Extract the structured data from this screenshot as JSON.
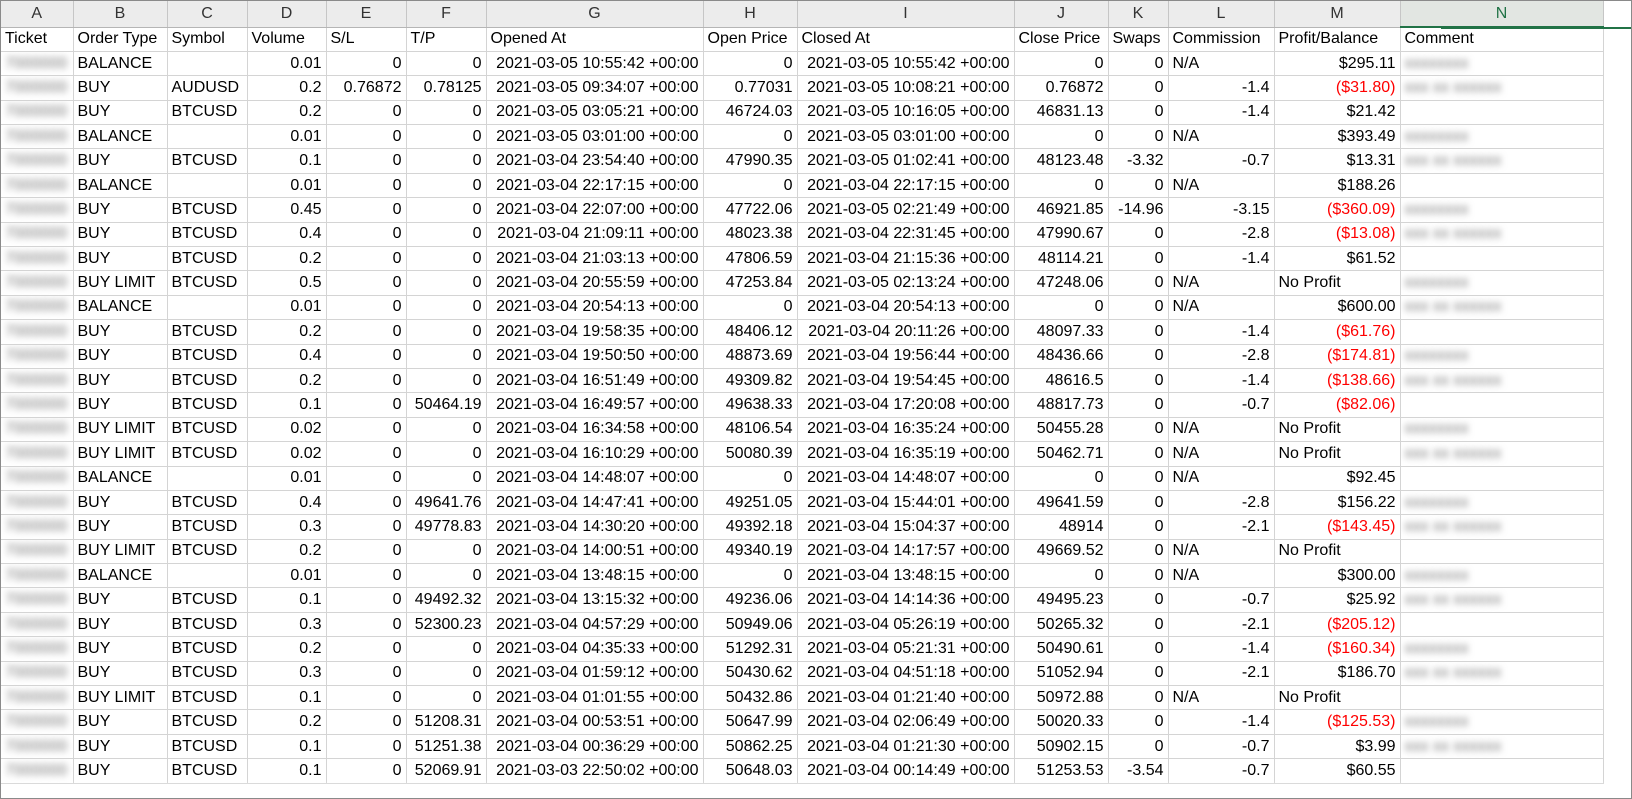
{
  "columns": [
    "A",
    "B",
    "C",
    "D",
    "E",
    "F",
    "G",
    "H",
    "I",
    "J",
    "K",
    "L",
    "M",
    "N"
  ],
  "selected_column": "N",
  "header_row": [
    "Ticket",
    "Order Type",
    "Symbol",
    "Volume",
    "S/L",
    "T/P",
    "Opened At",
    "Open Price",
    "Closed At",
    "Close Price",
    "Swaps",
    "Commission",
    "Profit/Balance",
    "Comment"
  ],
  "colors": {
    "negative": "#ff0000",
    "selected_header": "#217346",
    "grid": "#d4d4d4"
  },
  "rows": [
    [
      "BALANCE",
      "",
      "0.01",
      "0",
      "0",
      "2021-03-05 10:55:42 +00:00",
      "0",
      "2021-03-05 10:55:42 +00:00",
      "0",
      "0",
      "N/A",
      "$295.11"
    ],
    [
      "BUY",
      "AUDUSD",
      "0.2",
      "0.76872",
      "0.78125",
      "2021-03-05 09:34:07 +00:00",
      "0.77031",
      "2021-03-05 10:08:21 +00:00",
      "0.76872",
      "0",
      "-1.4",
      "($31.80)"
    ],
    [
      "BUY",
      "BTCUSD",
      "0.2",
      "0",
      "0",
      "2021-03-05 03:05:21 +00:00",
      "46724.03",
      "2021-03-05 10:16:05 +00:00",
      "46831.13",
      "0",
      "-1.4",
      "$21.42"
    ],
    [
      "BALANCE",
      "",
      "0.01",
      "0",
      "0",
      "2021-03-05 03:01:00 +00:00",
      "0",
      "2021-03-05 03:01:00 +00:00",
      "0",
      "0",
      "N/A",
      "$393.49"
    ],
    [
      "BUY",
      "BTCUSD",
      "0.1",
      "0",
      "0",
      "2021-03-04 23:54:40 +00:00",
      "47990.35",
      "2021-03-05 01:02:41 +00:00",
      "48123.48",
      "-3.32",
      "-0.7",
      "$13.31"
    ],
    [
      "BALANCE",
      "",
      "0.01",
      "0",
      "0",
      "2021-03-04 22:17:15 +00:00",
      "0",
      "2021-03-04 22:17:15 +00:00",
      "0",
      "0",
      "N/A",
      "$188.26"
    ],
    [
      "BUY",
      "BTCUSD",
      "0.45",
      "0",
      "0",
      "2021-03-04 22:07:00 +00:00",
      "47722.06",
      "2021-03-05 02:21:49 +00:00",
      "46921.85",
      "-14.96",
      "-3.15",
      "($360.09)"
    ],
    [
      "BUY",
      "BTCUSD",
      "0.4",
      "0",
      "0",
      "2021-03-04 21:09:11 +00:00",
      "48023.38",
      "2021-03-04 22:31:45 +00:00",
      "47990.67",
      "0",
      "-2.8",
      "($13.08)"
    ],
    [
      "BUY",
      "BTCUSD",
      "0.2",
      "0",
      "0",
      "2021-03-04 21:03:13 +00:00",
      "47806.59",
      "2021-03-04 21:15:36 +00:00",
      "48114.21",
      "0",
      "-1.4",
      "$61.52"
    ],
    [
      "BUY LIMIT",
      "BTCUSD",
      "0.5",
      "0",
      "0",
      "2021-03-04 20:55:59 +00:00",
      "47253.84",
      "2021-03-05 02:13:24 +00:00",
      "47248.06",
      "0",
      "N/A",
      "No Profit"
    ],
    [
      "BALANCE",
      "",
      "0.01",
      "0",
      "0",
      "2021-03-04 20:54:13 +00:00",
      "0",
      "2021-03-04 20:54:13 +00:00",
      "0",
      "0",
      "N/A",
      "$600.00"
    ],
    [
      "BUY",
      "BTCUSD",
      "0.2",
      "0",
      "0",
      "2021-03-04 19:58:35 +00:00",
      "48406.12",
      "2021-03-04 20:11:26 +00:00",
      "48097.33",
      "0",
      "-1.4",
      "($61.76)"
    ],
    [
      "BUY",
      "BTCUSD",
      "0.4",
      "0",
      "0",
      "2021-03-04 19:50:50 +00:00",
      "48873.69",
      "2021-03-04 19:56:44 +00:00",
      "48436.66",
      "0",
      "-2.8",
      "($174.81)"
    ],
    [
      "BUY",
      "BTCUSD",
      "0.2",
      "0",
      "0",
      "2021-03-04 16:51:49 +00:00",
      "49309.82",
      "2021-03-04 19:54:45 +00:00",
      "48616.5",
      "0",
      "-1.4",
      "($138.66)"
    ],
    [
      "BUY",
      "BTCUSD",
      "0.1",
      "0",
      "50464.19",
      "2021-03-04 16:49:57 +00:00",
      "49638.33",
      "2021-03-04 17:20:08 +00:00",
      "48817.73",
      "0",
      "-0.7",
      "($82.06)"
    ],
    [
      "BUY LIMIT",
      "BTCUSD",
      "0.02",
      "0",
      "0",
      "2021-03-04 16:34:58 +00:00",
      "48106.54",
      "2021-03-04 16:35:24 +00:00",
      "50455.28",
      "0",
      "N/A",
      "No Profit"
    ],
    [
      "BUY LIMIT",
      "BTCUSD",
      "0.02",
      "0",
      "0",
      "2021-03-04 16:10:29 +00:00",
      "50080.39",
      "2021-03-04 16:35:19 +00:00",
      "50462.71",
      "0",
      "N/A",
      "No Profit"
    ],
    [
      "BALANCE",
      "",
      "0.01",
      "0",
      "0",
      "2021-03-04 14:48:07 +00:00",
      "0",
      "2021-03-04 14:48:07 +00:00",
      "0",
      "0",
      "N/A",
      "$92.45"
    ],
    [
      "BUY",
      "BTCUSD",
      "0.4",
      "0",
      "49641.76",
      "2021-03-04 14:47:41 +00:00",
      "49251.05",
      "2021-03-04 15:44:01 +00:00",
      "49641.59",
      "0",
      "-2.8",
      "$156.22"
    ],
    [
      "BUY",
      "BTCUSD",
      "0.3",
      "0",
      "49778.83",
      "2021-03-04 14:30:20 +00:00",
      "49392.18",
      "2021-03-04 15:04:37 +00:00",
      "48914",
      "0",
      "-2.1",
      "($143.45)"
    ],
    [
      "BUY LIMIT",
      "BTCUSD",
      "0.2",
      "0",
      "0",
      "2021-03-04 14:00:51 +00:00",
      "49340.19",
      "2021-03-04 14:17:57 +00:00",
      "49669.52",
      "0",
      "N/A",
      "No Profit"
    ],
    [
      "BALANCE",
      "",
      "0.01",
      "0",
      "0",
      "2021-03-04 13:48:15 +00:00",
      "0",
      "2021-03-04 13:48:15 +00:00",
      "0",
      "0",
      "N/A",
      "$300.00"
    ],
    [
      "BUY",
      "BTCUSD",
      "0.1",
      "0",
      "49492.32",
      "2021-03-04 13:15:32 +00:00",
      "49236.06",
      "2021-03-04 14:14:36 +00:00",
      "49495.23",
      "0",
      "-0.7",
      "$25.92"
    ],
    [
      "BUY",
      "BTCUSD",
      "0.3",
      "0",
      "52300.23",
      "2021-03-04 04:57:29 +00:00",
      "50949.06",
      "2021-03-04 05:26:19 +00:00",
      "50265.32",
      "0",
      "-2.1",
      "($205.12)"
    ],
    [
      "BUY",
      "BTCUSD",
      "0.2",
      "0",
      "0",
      "2021-03-04 04:35:33 +00:00",
      "51292.31",
      "2021-03-04 05:21:31 +00:00",
      "50490.61",
      "0",
      "-1.4",
      "($160.34)"
    ],
    [
      "BUY",
      "BTCUSD",
      "0.3",
      "0",
      "0",
      "2021-03-04 01:59:12 +00:00",
      "50430.62",
      "2021-03-04 04:51:18 +00:00",
      "51052.94",
      "0",
      "-2.1",
      "$186.70"
    ],
    [
      "BUY LIMIT",
      "BTCUSD",
      "0.1",
      "0",
      "0",
      "2021-03-04 01:01:55 +00:00",
      "50432.86",
      "2021-03-04 01:21:40 +00:00",
      "50972.88",
      "0",
      "N/A",
      "No Profit"
    ],
    [
      "BUY",
      "BTCUSD",
      "0.2",
      "0",
      "51208.31",
      "2021-03-04 00:53:51 +00:00",
      "50647.99",
      "2021-03-04 02:06:49 +00:00",
      "50020.33",
      "0",
      "-1.4",
      "($125.53)"
    ],
    [
      "BUY",
      "BTCUSD",
      "0.1",
      "0",
      "51251.38",
      "2021-03-04 00:36:29 +00:00",
      "50862.25",
      "2021-03-04 01:21:30 +00:00",
      "50902.15",
      "0",
      "-0.7",
      "$3.99"
    ],
    [
      "BUY",
      "BTCUSD",
      "0.1",
      "0",
      "52069.91",
      "2021-03-03 22:50:02 +00:00",
      "50648.03",
      "2021-03-04 00:14:49 +00:00",
      "51253.53",
      "-3.54",
      "-0.7",
      "$60.55"
    ]
  ]
}
